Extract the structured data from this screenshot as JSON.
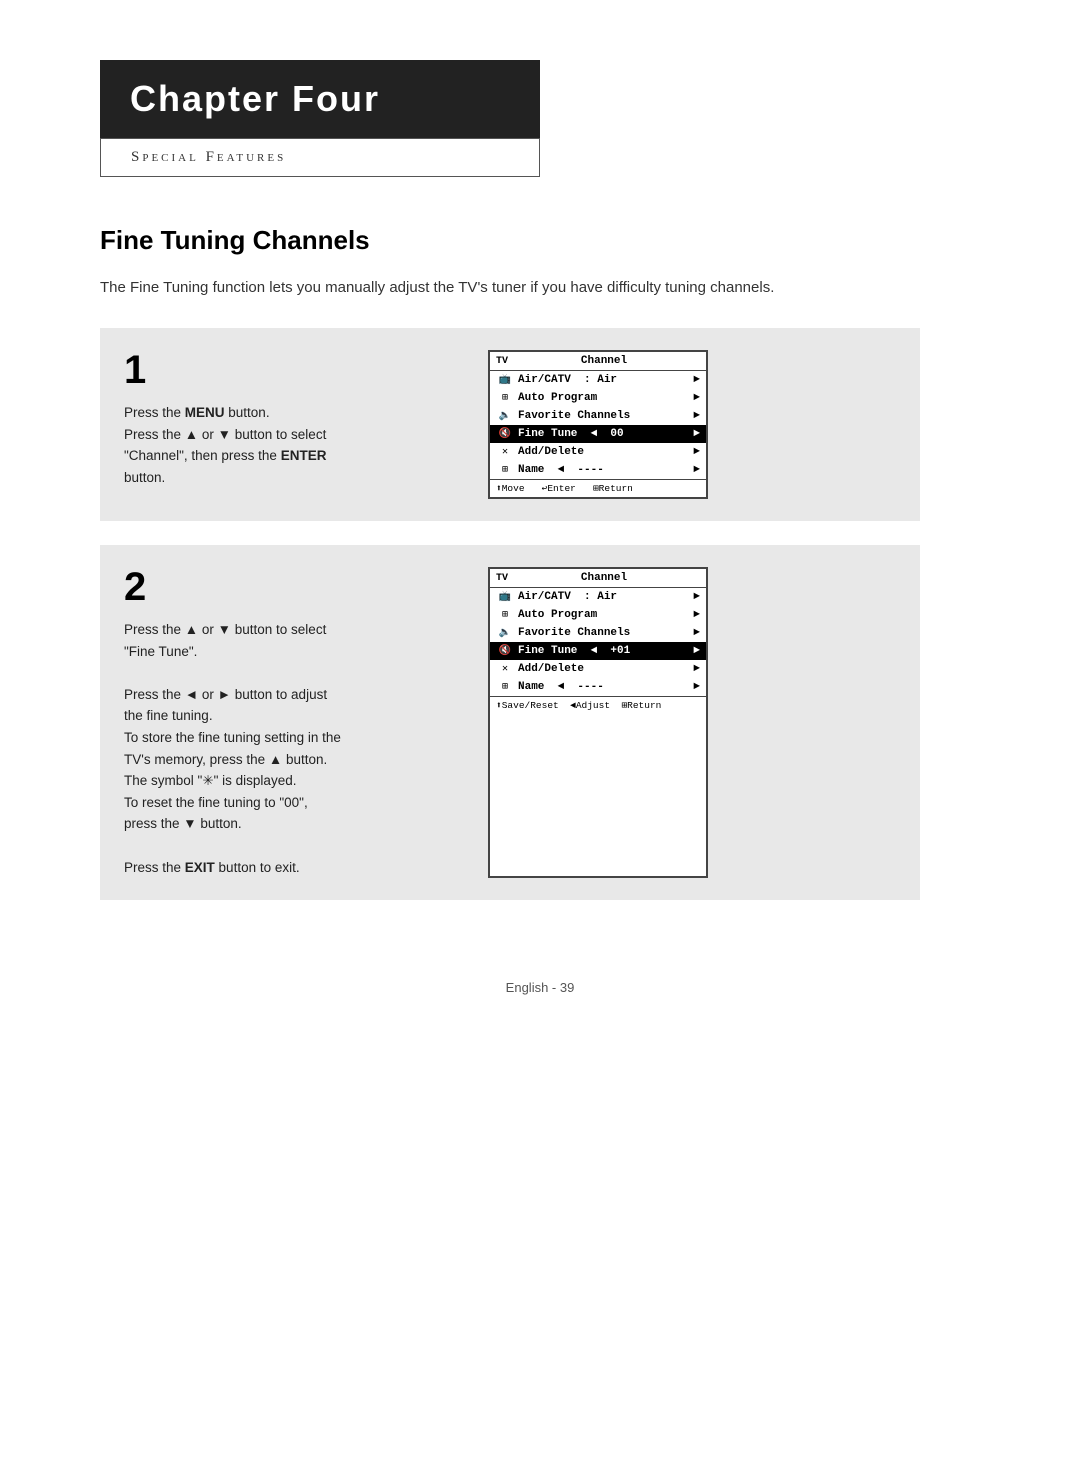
{
  "chapter": {
    "title": "Chapter Four",
    "subtitle": "Special Features"
  },
  "section": {
    "title": "Fine Tuning Channels",
    "intro": "The Fine Tuning function lets you manually adjust the TV's tuner if you have difficulty tuning channels."
  },
  "steps": [
    {
      "number": "1",
      "instructions": [
        {
          "text": "Press the ",
          "bold": ""
        },
        {
          "text": "MENU",
          "bold": "true"
        },
        {
          "text": " button.",
          "bold": ""
        }
      ],
      "instruction_html": "Press the <strong>MENU</strong> button.\nPress the ▲ or ▼ button to select\n\"Channel\", then press the <strong>ENTER</strong>\nbutton.",
      "screen": {
        "tv_label": "TV",
        "channel_label": "Channel",
        "rows": [
          {
            "icon": "📡",
            "label": "Air/CATV",
            "sep": ":",
            "value": "Air",
            "arrow": "►",
            "highlight": false
          },
          {
            "icon": "⊞",
            "label": "Auto Program",
            "value": "",
            "arrow": "►",
            "highlight": false
          },
          {
            "icon": "🔊",
            "label": "Favorite Channels",
            "value": "",
            "arrow": "►",
            "highlight": false
          },
          {
            "icon": "🔇",
            "label": "Fine Tune",
            "left": "◄",
            "value": "00",
            "arrow": "►",
            "highlight": true
          },
          {
            "icon": "✕",
            "label": "Add/Delete",
            "value": "",
            "arrow": "►",
            "highlight": false
          },
          {
            "icon": "⚙",
            "label": "Name",
            "left": "◄",
            "value": "----",
            "arrow": "►",
            "highlight": false
          }
        ],
        "footer": "⬆Move   ↩Enter   ⊞Return"
      }
    },
    {
      "number": "2",
      "instruction_html": "Press the ▲ or ▼ button to select\n\"Fine Tune\".\n\nPress the ◄ or ► button to adjust\nthe fine tuning.\nTo store the fine tuning setting in the\nTV's memory, press the ▲ button.\nThe symbol \"✳\" is displayed.\nTo reset the fine tuning to \"00\",\npress the ▼ button.\n\nPress the EXIT button to exit.",
      "screen": {
        "tv_label": "TV",
        "channel_label": "Channel",
        "rows": [
          {
            "icon": "📡",
            "label": "Air/CATV",
            "sep": ":",
            "value": "Air",
            "arrow": "►",
            "highlight": false
          },
          {
            "icon": "⊞",
            "label": "Auto Program",
            "value": "",
            "arrow": "►",
            "highlight": false
          },
          {
            "icon": "🔊",
            "label": "Favorite Channels",
            "value": "",
            "arrow": "►",
            "highlight": false
          },
          {
            "icon": "🔇",
            "label": "Fine Tune",
            "left": "◄",
            "value": "+01",
            "arrow": "►",
            "highlight": true
          },
          {
            "icon": "✕",
            "label": "Add/Delete",
            "value": "",
            "arrow": "►",
            "highlight": false
          },
          {
            "icon": "⚙",
            "label": "Name",
            "left": "◄",
            "value": "----",
            "arrow": "►",
            "highlight": false
          }
        ],
        "footer": "⬆Save/Reset  ◄Adjust  ⊞Return"
      }
    }
  ],
  "footer": {
    "page": "English - 39"
  }
}
